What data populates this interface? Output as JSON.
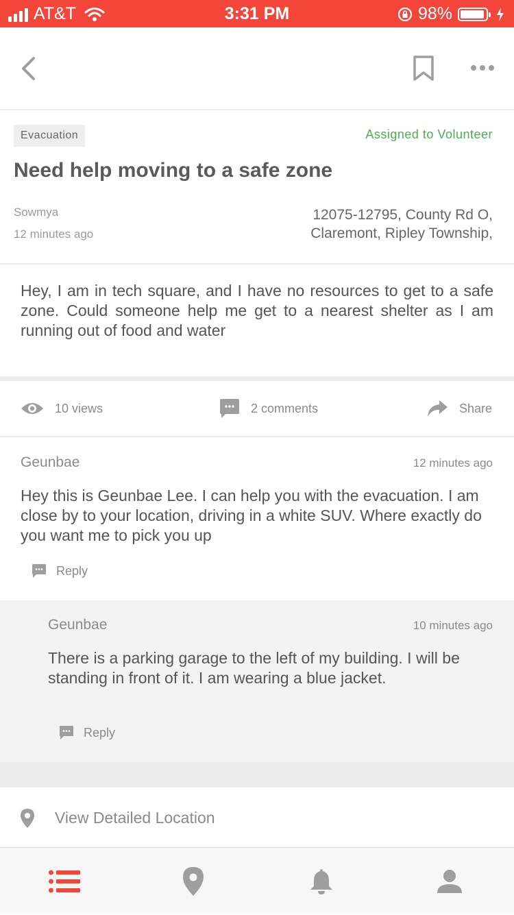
{
  "status_bar": {
    "carrier": "AT&T",
    "time": "3:31 PM",
    "battery": "98%"
  },
  "post": {
    "category": "Evacuation",
    "status": "Assigned to Volunteer",
    "title": "Need help moving to a safe zone",
    "author": "Sowmya",
    "posted": "12 minutes ago",
    "address_line1": "12075-12795, County Rd O,",
    "address_line2": "Claremont, Ripley Township,",
    "body": "Hey, I am in tech square, and I have no resources to get to a safe zone. Could someone help me get to a nearest shelter as I am running out of food and water"
  },
  "stats": {
    "views": "10 views",
    "comments": "2 comments",
    "share": "Share"
  },
  "comments": [
    {
      "author": "Geunbae",
      "time": "12 minutes ago",
      "text": "Hey this is Geunbae Lee. I can help you with the evacuation. I am close by to your location, driving in a white SUV. Where exactly do you want me to pick you up",
      "reply_label": "Reply"
    },
    {
      "author": "Geunbae",
      "time": "10 minutes ago",
      "text": "There is a parking garage to the left of my building. I will be standing in front of it. I am wearing a blue jacket.",
      "reply_label": "Reply"
    }
  ],
  "location_link": "View Detailed Location",
  "colors": {
    "accent": "#f4453a",
    "assigned_green": "#4caf50",
    "icon_gray": "#9e9e9e"
  },
  "icons": [
    "back-icon",
    "bookmark-icon",
    "more-icon",
    "eye-icon",
    "comment-icon",
    "share-icon",
    "reply-icon",
    "location-pin-icon",
    "list-icon",
    "map-pin-icon",
    "bell-icon",
    "profile-icon"
  ]
}
